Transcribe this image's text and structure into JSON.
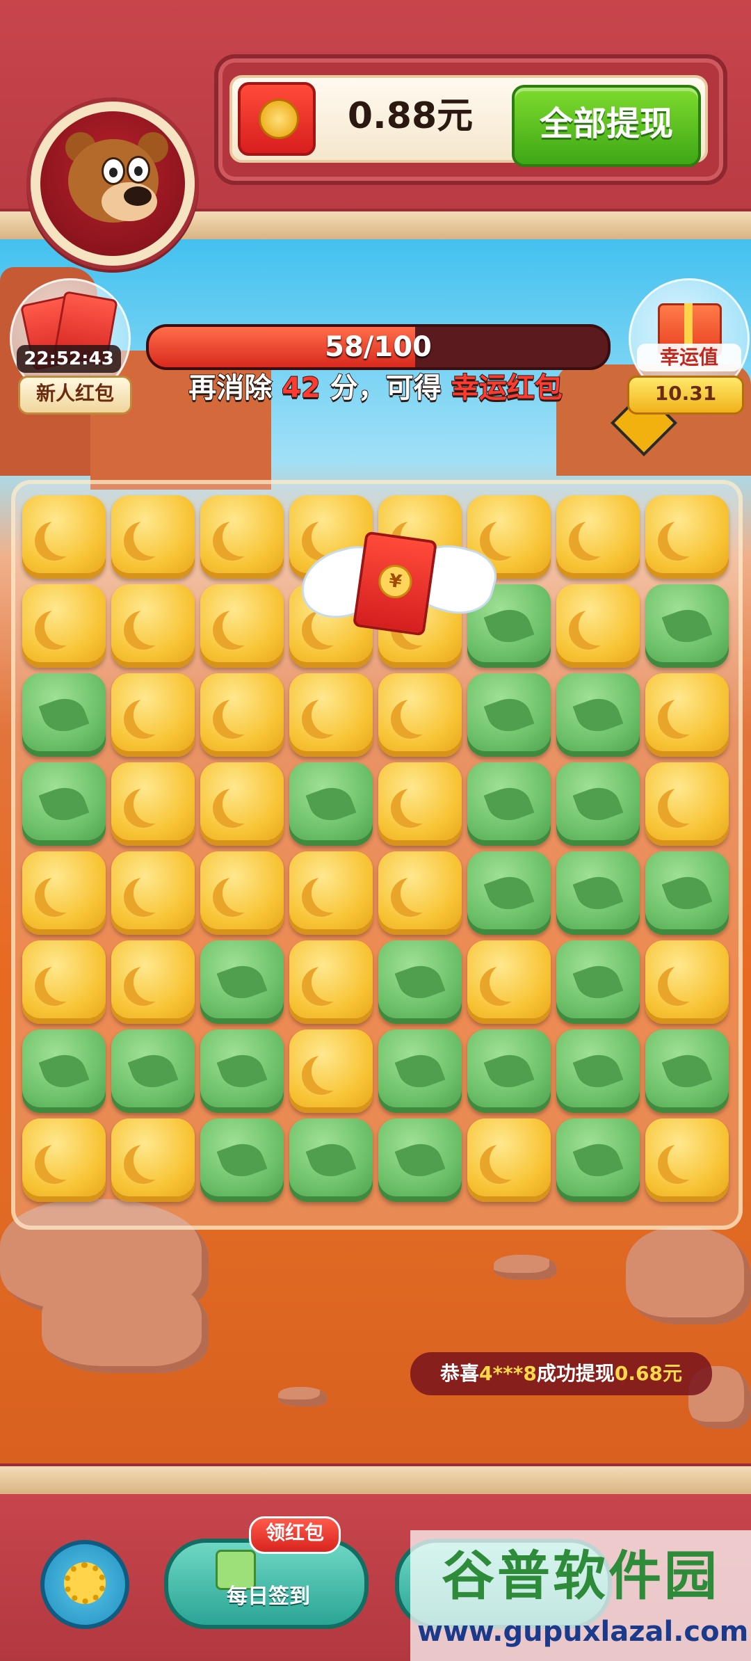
{
  "wallet": {
    "amount": "0.88元",
    "withdraw_label": "全部提现"
  },
  "newbie": {
    "timer": "22:52:43",
    "label": "新人红包"
  },
  "lucky": {
    "title": "幸运值",
    "value": "10.31"
  },
  "progress": {
    "text": "58/100",
    "current": 58,
    "max": 100
  },
  "hint": {
    "prefix": "再消除",
    "points": "42",
    "middle": "分，可得",
    "reward": "幸运红包"
  },
  "flying_envelope": {
    "symbol": "¥"
  },
  "board": {
    "rows": [
      [
        "moon",
        "moon",
        "moon",
        "moon",
        "moon",
        "moon",
        "moon",
        "moon"
      ],
      [
        "moon",
        "moon",
        "moon",
        "moon",
        "moon",
        "leaf",
        "moon",
        "leaf"
      ],
      [
        "leaf",
        "moon",
        "moon",
        "moon",
        "moon",
        "leaf",
        "leaf",
        "moon"
      ],
      [
        "leaf",
        "moon",
        "moon",
        "leaf",
        "moon",
        "leaf",
        "leaf",
        "moon"
      ],
      [
        "moon",
        "moon",
        "moon",
        "moon",
        "moon",
        "leaf",
        "leaf",
        "leaf"
      ],
      [
        "moon",
        "moon",
        "leaf",
        "moon",
        "leaf",
        "moon",
        "leaf",
        "moon"
      ],
      [
        "leaf",
        "leaf",
        "leaf",
        "moon",
        "leaf",
        "leaf",
        "leaf",
        "leaf"
      ],
      [
        "moon",
        "moon",
        "leaf",
        "leaf",
        "leaf",
        "moon",
        "leaf",
        "moon"
      ]
    ]
  },
  "ticker": {
    "prefix": "恭喜",
    "user": "4***8",
    "middle": "成功提现",
    "amount": "0.68元"
  },
  "bottom": {
    "signin_tag": "领红包",
    "signin_label": "每日签到"
  },
  "watermark": {
    "title": "谷普软件园",
    "url": "www.gupuxlazal.com"
  },
  "colors": {
    "header": "#c8454c",
    "withdraw": "#3ea716",
    "accent_red": "#ff3b2f"
  }
}
